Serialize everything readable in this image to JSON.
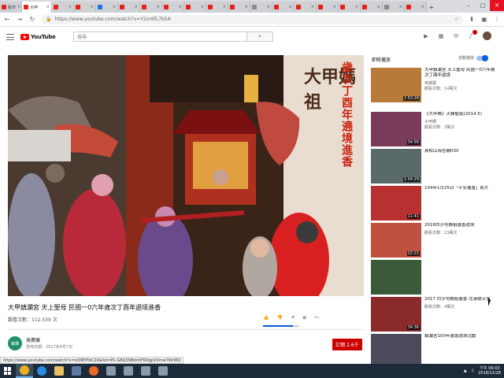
{
  "browser": {
    "tabs": [
      {
        "label": "股市",
        "icon": "youtube-favicon"
      },
      {
        "label": "大甲",
        "icon": "youtube-favicon",
        "active": true
      },
      {
        "label": "",
        "icon": "youtube-favicon"
      },
      {
        "label": "",
        "icon": "youtube-favicon"
      },
      {
        "label": "",
        "icon": "google-favicon"
      },
      {
        "label": "",
        "icon": "youtube-favicon"
      },
      {
        "label": "",
        "icon": "youtube-favicon"
      },
      {
        "label": "",
        "icon": "youtube-favicon"
      },
      {
        "label": "",
        "icon": "youtube-favicon"
      },
      {
        "label": "",
        "icon": "youtube-favicon"
      },
      {
        "label": "",
        "icon": "youtube-favicon"
      },
      {
        "label": "",
        "icon": "web-favicon"
      },
      {
        "label": "",
        "icon": "youtube-favicon"
      },
      {
        "label": "",
        "icon": "youtube-favicon"
      },
      {
        "label": "",
        "icon": "youtube-favicon"
      },
      {
        "label": "",
        "icon": "youtube-favicon"
      },
      {
        "label": "",
        "icon": "youtube-favicon"
      },
      {
        "label": "",
        "icon": "web-favicon"
      },
      {
        "label": "",
        "icon": "youtube-favicon"
      }
    ],
    "address": "https://www.youtube.com/watch?v=Y2or6fL7b5A",
    "status_url": "https://www.youtube.com/watch?v=iz09EPlbC2k&list=PL-G8Q3SBdnhFKOgpVVmw7WrI8Q"
  },
  "youtube": {
    "logo_text": "YouTube",
    "search_placeholder": "搜尋"
  },
  "video": {
    "overlay_logo": "大甲媽祖",
    "overlay_title": "歲次丁酉年遶境進香",
    "title": "大甲鎮瀾宮 天上聖母 民國一0六年歲次丁酉年遶境進香",
    "views": "觀看次數：112,539 次",
    "like_fraction": 0.82
  },
  "channel": {
    "avatar_text": "鎮瀾",
    "name": "吳廣展",
    "published": "發佈日期：2017年4月7日",
    "subscribe_label": "訂閱 2.6千"
  },
  "sidebar": {
    "up_next": "即將播放",
    "autoplay_label": "自動播放",
    "items": [
      {
        "title": "大甲鎮瀾宮 天上聖母 民國一0六年歲次丁酉年遶境",
        "channel": "吳廣展",
        "views": "觀看次數：14萬次",
        "duration": "1:53:26",
        "color": "#b87a3a"
      },
      {
        "title": "《大甲媽》天驛聖誕(2014.5)",
        "channel": "大甲媽",
        "views": "觀看次數：3萬次",
        "duration": "34:56",
        "color": "#7a3a5a"
      },
      {
        "title": "鳥松山海宮廟030",
        "channel": "",
        "views": "",
        "duration": "1:04:29",
        "color": "#5a6a6a"
      },
      {
        "title": "104年1月25日「平安進香」影片",
        "channel": "",
        "views": "",
        "duration": "11:41",
        "color": "#b83030"
      },
      {
        "title": "2018白沙屯媽祖進香遶境",
        "channel": "",
        "views": "觀看次數：13萬次",
        "duration": "22:21",
        "color": "#c05040"
      },
      {
        "title": "",
        "channel": "",
        "views": "",
        "duration": "",
        "color": "#3a5a3a"
      },
      {
        "title": "2017 白沙屯媽祖進香 北港朝天宮",
        "channel": "",
        "views": "觀看次數：4萬次",
        "duration": "34:36",
        "color": "#8a2a2a"
      },
      {
        "title": "鎮瀾宮100年進香遶境活動",
        "channel": "",
        "views": "",
        "duration": "",
        "color": "#4a4a5a"
      }
    ]
  },
  "taskbar": {
    "apps": [
      "chrome",
      "ie",
      "folder",
      "media",
      "firefox",
      "app",
      "app",
      "app",
      "app"
    ],
    "time": "下午 06:03",
    "date": "2018/12/28"
  }
}
